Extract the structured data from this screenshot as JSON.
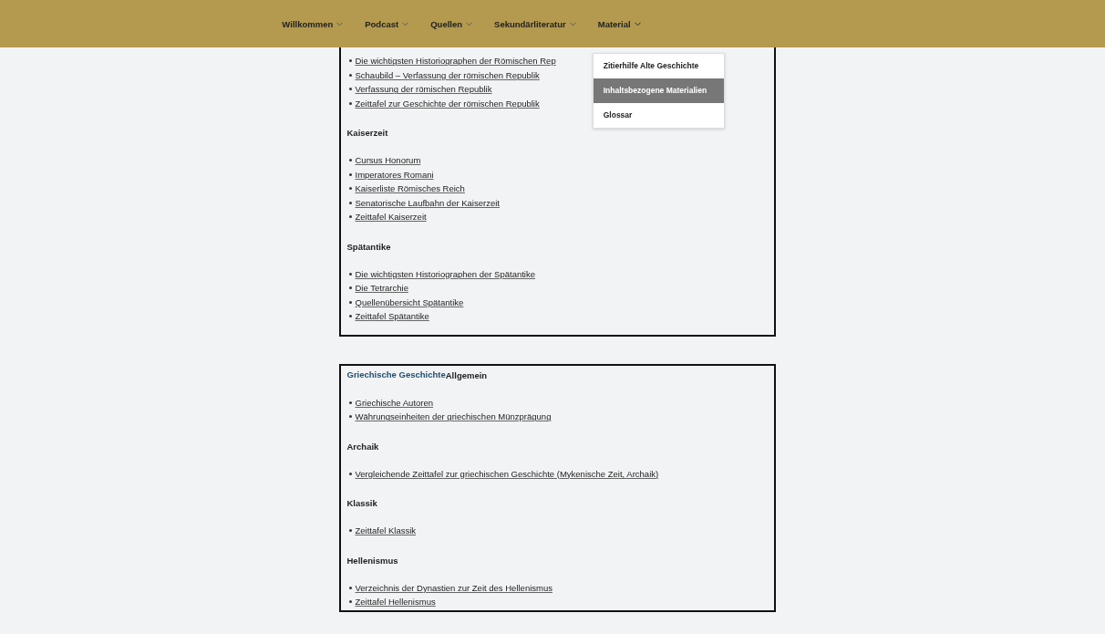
{
  "nav": [
    {
      "label": "Willkommen",
      "expanded": false
    },
    {
      "label": "Podcast",
      "expanded": false
    },
    {
      "label": "Quellen",
      "expanded": false
    },
    {
      "label": "Sekundärliteratur",
      "expanded": false
    },
    {
      "label": "Material",
      "expanded": true,
      "menu": [
        {
          "label": "Zitierhilfe Alte Geschichte",
          "selected": false
        },
        {
          "label": "Inhaltsbezogene Materialien",
          "selected": true
        },
        {
          "label": "Glossar",
          "selected": false
        }
      ]
    }
  ],
  "boxes": [
    {
      "groups": [
        {
          "links": [
            "Die wichtigsten Historiographen der Römischen Rep",
            "Schaubild – Verfassung der römischen Republik",
            "Verfassung der römischen Republik",
            "Zeittafel zur Geschichte der römischen Republik"
          ]
        },
        {
          "heading": "Kaiserzeit",
          "links": [
            "Cursus Honorum",
            "Imperatores Romani",
            "Kaiserliste Römisches Reich",
            "Senatorische Laufbahn der Kaiserzeit",
            "Zeittafel Kaiserzeit"
          ]
        },
        {
          "heading": "Spätantike",
          "links": [
            "Die wichtigsten Historiographen der Spätantike",
            "Die Tetrarchie",
            "Quellenübersicht Spätantike",
            "Zeittafel Spätantike"
          ]
        }
      ]
    },
    {
      "title": "Griechische Geschichte",
      "groups": [
        {
          "heading": "Allgemein",
          "links": [
            "Griechische Autoren",
            "Währungseinheiten der griechischen Münzprägung"
          ]
        },
        {
          "heading": "Archaik",
          "links": [
            "Vergleichende Zeittafel zur griechischen Geschichte (Mykenische Zeit, Archaik)"
          ]
        },
        {
          "heading": "Klassik",
          "links": [
            "Zeittafel Klassik"
          ]
        },
        {
          "heading": "Hellenismus",
          "links": [
            "Verzeichnis der Dynastien zur Zeit des Hellenismus",
            "Zeittafel Hellenismus"
          ]
        }
      ]
    }
  ]
}
